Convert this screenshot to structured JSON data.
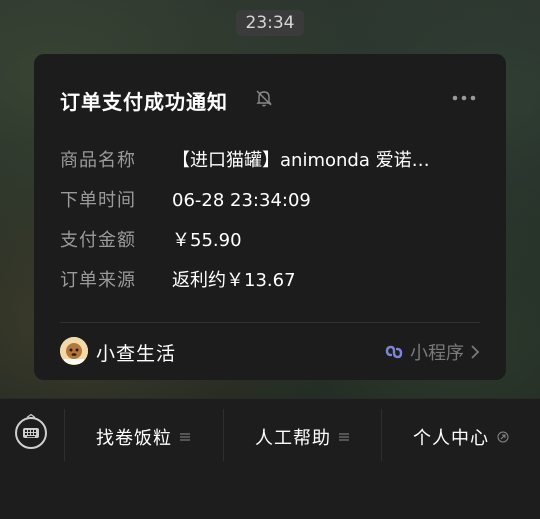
{
  "status": {
    "time": "23:34"
  },
  "card": {
    "title": "订单支付成功通知",
    "rows": [
      {
        "label": "商品名称",
        "value": "【进口猫罐】animonda 爱诺…"
      },
      {
        "label": "下单时间",
        "value": "06-28 23:34:09"
      },
      {
        "label": "支付金额",
        "value": "￥55.90"
      },
      {
        "label": "订单来源",
        "value": "返利约￥13.67"
      }
    ],
    "mini_program_name": "小查生活",
    "mini_program_tag": "小程序"
  },
  "menu": {
    "tabs": [
      {
        "label": "找卷饭粒"
      },
      {
        "label": "人工帮助"
      },
      {
        "label": "个人中心"
      }
    ]
  },
  "icons": {
    "mute": "bell-slash-icon",
    "more": "more-dots-icon",
    "link": "mini-program-link-icon",
    "keyboard": "keyboard-icon"
  }
}
